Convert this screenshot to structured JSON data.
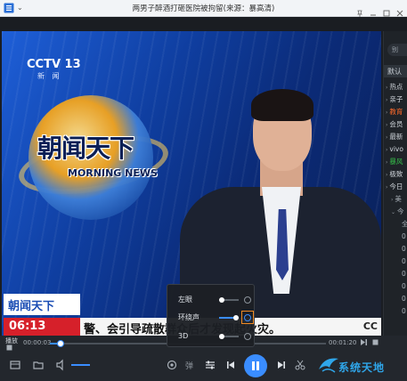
{
  "window": {
    "title": "两男子醉酒打砸医院被拘留(来源：暴高清)"
  },
  "video": {
    "channel_logo": "CCTV 13",
    "channel_sub": "新 闻",
    "show_title": "朝闻天下",
    "show_subtitle": "MORNING NEWS",
    "lower_third_label": "朝闻天下",
    "clock": "06:13",
    "ticker": "警、会引导疏散群众后才发现起火灾。",
    "ticker_badge": "CC"
  },
  "sidepanel": {
    "search_placeholder": "别",
    "tab_label": "默认",
    "items": [
      {
        "label": "热点",
        "style": "normal"
      },
      {
        "label": "亲子",
        "style": "normal"
      },
      {
        "label": "教育",
        "style": "hl"
      },
      {
        "label": "会员",
        "style": "normal"
      },
      {
        "label": "最新",
        "style": "normal"
      },
      {
        "label": "vivo",
        "style": "normal"
      },
      {
        "label": "暴风",
        "style": "gr"
      },
      {
        "label": "极致",
        "style": "normal"
      },
      {
        "label": "今日",
        "style": "normal"
      },
      {
        "label": "美",
        "style": "sub"
      },
      {
        "label": "今",
        "style": "sub"
      },
      {
        "label": "全",
        "style": "sub2"
      },
      {
        "label": "0",
        "style": "sub2"
      },
      {
        "label": "0",
        "style": "sub2"
      },
      {
        "label": "0",
        "style": "sub2"
      },
      {
        "label": "0",
        "style": "sub2"
      },
      {
        "label": "0",
        "style": "sub2"
      },
      {
        "label": "0",
        "style": "sub2"
      },
      {
        "label": "0",
        "style": "sub2"
      }
    ]
  },
  "controls": {
    "play_label": "播放",
    "time_current": "00:00:03",
    "time_total": "00:01:20",
    "progress_fraction": 0.04,
    "volume_fraction": 0.7,
    "danmu_label": "弹"
  },
  "popup_3d": {
    "rows": [
      {
        "label": "左眼",
        "on": false
      },
      {
        "label": "环绕声",
        "on": true
      },
      {
        "label": "3D",
        "on": false
      }
    ]
  },
  "watermark": {
    "text": "系统天地"
  },
  "colors": {
    "accent": "#3a8dff",
    "highlight_orange": "#f08a24",
    "clock_red": "#d6202a"
  }
}
